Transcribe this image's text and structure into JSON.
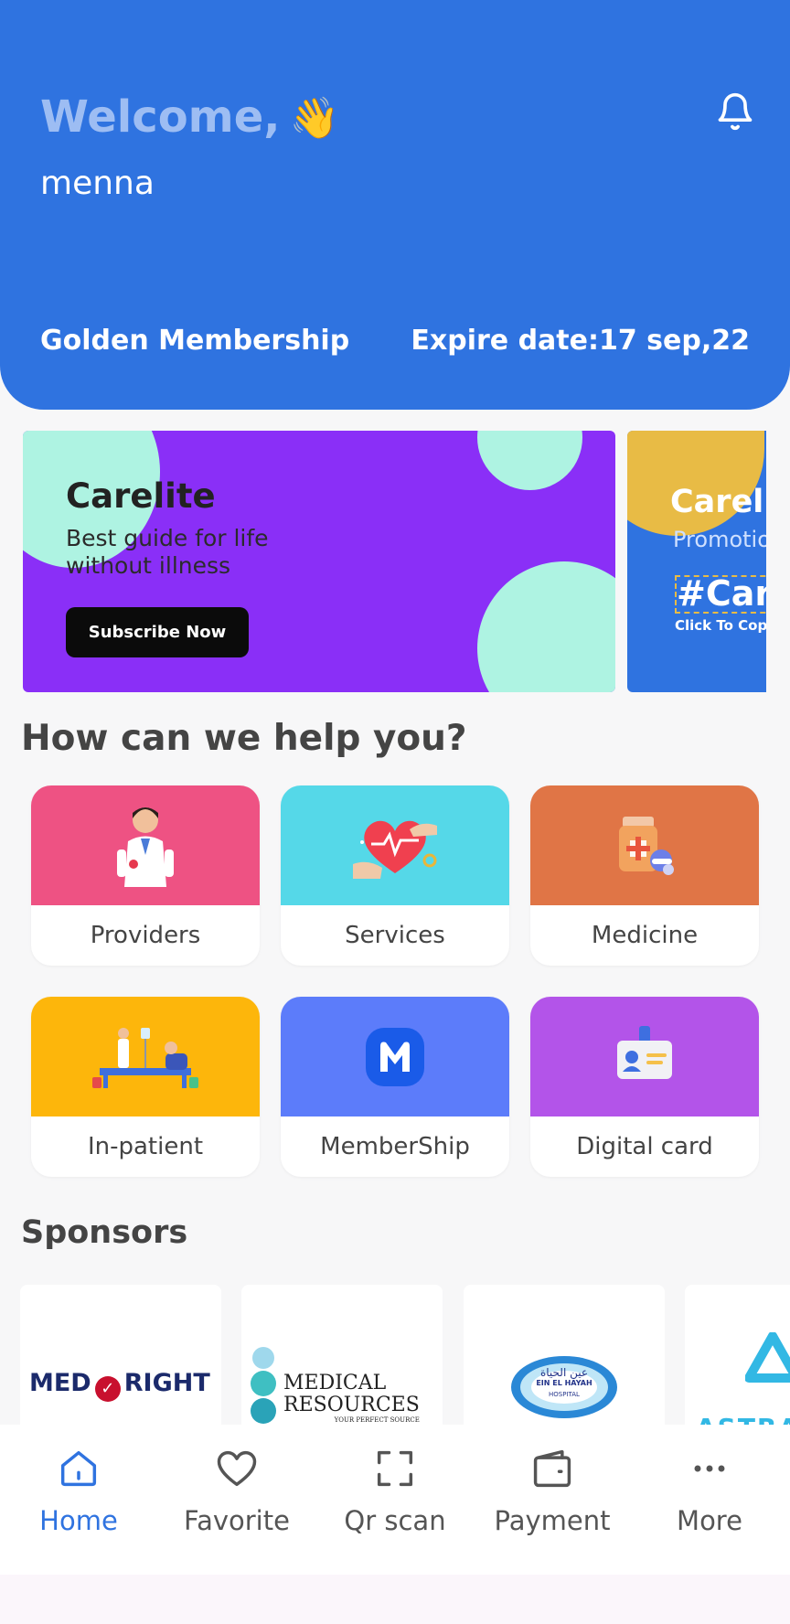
{
  "header": {
    "welcome": "Welcome,",
    "wave_emoji": "👋",
    "username": "menna",
    "membership": "Golden Membership",
    "expire": "Expire date:17 sep,22"
  },
  "banners": [
    {
      "title": "Carelite",
      "subtitle_line1": "Best guide for life",
      "subtitle_line2": "without illness",
      "button": "Subscribe Now",
      "bg_color": "#8a2ff7"
    },
    {
      "title": "Careli",
      "subtitle": "Promotio",
      "code": "#Car",
      "hint": "Click To Copy",
      "bg_color": "#2f73e0"
    }
  ],
  "help_section": {
    "title": "How can we help you?",
    "tiles": [
      {
        "label": "Providers",
        "color": "#ee5283",
        "icon": "doctor-icon"
      },
      {
        "label": "Services",
        "color": "#55d8e8",
        "icon": "heart-care-icon"
      },
      {
        "label": "Medicine",
        "color": "#e07546",
        "icon": "medicine-bottle-icon"
      },
      {
        "label": "In-patient",
        "color": "#fdb60b",
        "icon": "hospital-bed-icon"
      },
      {
        "label": "MemberShip",
        "color": "#5c7cfa",
        "icon": "membership-m-icon"
      },
      {
        "label": "Digital card",
        "color": "#b354e9",
        "icon": "id-card-icon"
      }
    ]
  },
  "sponsors": {
    "title": "Sponsors",
    "items": [
      {
        "name_part1": "MED",
        "name_part2": "RIGHT"
      },
      {
        "line1": "MEDICAL",
        "line2": "RESOURCES",
        "tagline": "YOUR PERFECT SOURCE"
      },
      {
        "arabic": "عين الحياة",
        "english": "EIN EL HAYAH",
        "sub": "HOSPITAL"
      },
      {
        "name": "ASTRA"
      }
    ]
  },
  "nav": {
    "items": [
      {
        "label": "Home",
        "icon": "home-icon",
        "active": true
      },
      {
        "label": "Favorite",
        "icon": "heart-icon",
        "active": false
      },
      {
        "label": "Qr scan",
        "icon": "qr-scan-icon",
        "active": false
      },
      {
        "label": "Payment",
        "icon": "wallet-icon",
        "active": false
      },
      {
        "label": "More",
        "icon": "more-icon",
        "active": false
      }
    ],
    "active_color": "#2f73e0"
  }
}
